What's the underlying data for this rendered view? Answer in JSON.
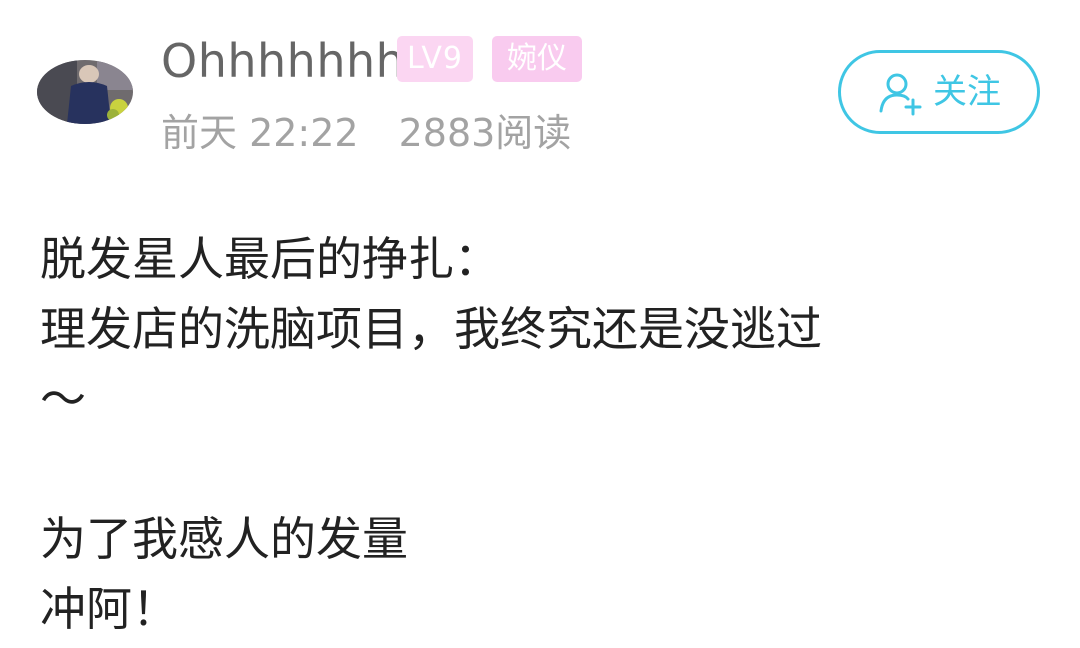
{
  "user": {
    "name": "Ohhhhhhh",
    "level_badge": "LV9",
    "title_badge": "婉仪",
    "avatar_icon": "user-avatar-photo"
  },
  "meta": {
    "time": "前天 22:22",
    "reads": "2883阅读"
  },
  "follow_button": {
    "label": "关注",
    "icon": "add-user-icon",
    "color": "#3fc6e4"
  },
  "post": {
    "lines": [
      "脱发星人最后的挣扎：",
      "理发店的洗脑项目，我终究还是没逃过",
      "～",
      "为了我感人的发量",
      "冲阿！"
    ]
  },
  "colors": {
    "level_badge_bg": "#fbd6f2",
    "title_badge_bg": "#f9cbef",
    "username": "#666666",
    "meta_text": "#a3a3a3",
    "body_text": "#222222"
  }
}
